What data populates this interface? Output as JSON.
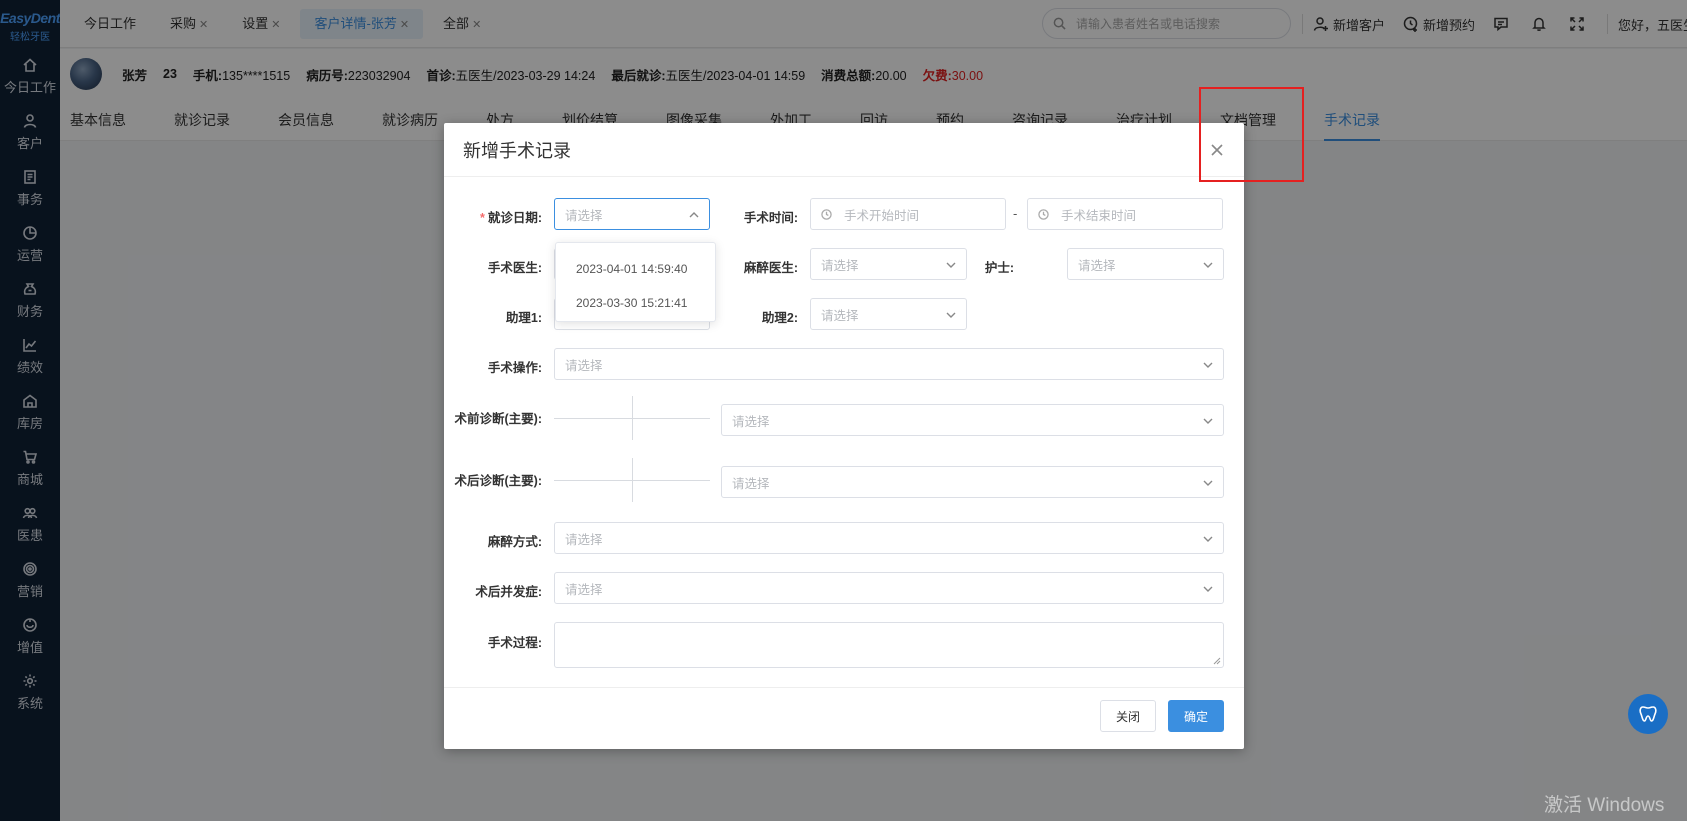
{
  "sidebar": {
    "logo": "EasyDent",
    "logo_sub": "轻松牙医",
    "items": [
      {
        "label": "今日工作",
        "icon": "home-icon"
      },
      {
        "label": "客户",
        "icon": "user-icon"
      },
      {
        "label": "事务",
        "icon": "document-icon"
      },
      {
        "label": "运营",
        "icon": "pie-chart-icon"
      },
      {
        "label": "财务",
        "icon": "money-bag-icon"
      },
      {
        "label": "绩效",
        "icon": "line-chart-icon"
      },
      {
        "label": "库房",
        "icon": "warehouse-icon"
      },
      {
        "label": "商城",
        "icon": "cart-icon"
      },
      {
        "label": "医患",
        "icon": "people-icon"
      },
      {
        "label": "营销",
        "icon": "target-icon"
      },
      {
        "label": "增值",
        "icon": "gift-icon"
      },
      {
        "label": "系统",
        "icon": "gear-icon"
      }
    ]
  },
  "topbar": {
    "tabs": [
      {
        "label": "今日工作",
        "closable": false
      },
      {
        "label": "采购",
        "closable": true
      },
      {
        "label": "设置",
        "closable": true
      },
      {
        "label": "客户详情-张芳",
        "closable": true,
        "active": true
      },
      {
        "label": "全部",
        "closable": true
      }
    ],
    "search_placeholder": "请输入患者姓名或电话搜索",
    "new_customer": "新增客户",
    "new_appointment": "新增预约",
    "greeting": "您好，五医生"
  },
  "patient": {
    "name": "张芳",
    "age": "23",
    "phone_label": "手机:",
    "phone": "135****1515",
    "record_label": "病历号:",
    "record": "223032904",
    "first_visit_label": "首诊:",
    "first_visit": "五医生/2023-03-29 14:24",
    "last_visit_label": "最后就诊:",
    "last_visit": "五医生/2023-04-01 14:59",
    "spend_label": "消费总额:",
    "spend": "20.00",
    "owe_label": "欠费:",
    "owe": "30.00"
  },
  "detail_tabs": [
    "基本信息",
    "就诊记录",
    "会员信息",
    "就诊病历",
    "处方",
    "划价结算",
    "图像采集",
    "外加工",
    "回访",
    "预约",
    "咨询记录",
    "治疗计划",
    "文档管理",
    "手术记录"
  ],
  "modal": {
    "title": "新增手术记录",
    "visit_date_label": "就诊日期:",
    "visit_date_placeholder": "请选择",
    "visit_date_options": [
      "2023-04-01 14:59:40",
      "2023-03-30 15:21:41"
    ],
    "surgery_time_label": "手术时间:",
    "start_placeholder": "手术开始时间",
    "end_placeholder": "手术结束时间",
    "range_sep": "-",
    "surgeon_label": "手术医生:",
    "anesthetist_label": "麻醉医生:",
    "anesthetist_placeholder": "请选择",
    "nurse_label": "护士:",
    "nurse_placeholder": "请选择",
    "assistant1_label": "助理1:",
    "assistant2_label": "助理2:",
    "assistant2_placeholder": "请选择",
    "operation_label": "手术操作:",
    "operation_placeholder": "请选择",
    "pre_diag_label": "术前诊断(主要):",
    "pre_diag_placeholder": "请选择",
    "post_diag_label": "术后诊断(主要):",
    "post_diag_placeholder": "请选择",
    "anesthesia_label": "麻醉方式:",
    "anesthesia_placeholder": "请选择",
    "complication_label": "术后并发症:",
    "complication_placeholder": "请选择",
    "process_label": "手术过程:",
    "close_button": "关闭",
    "confirm_button": "确定"
  },
  "watermark": "激活 Windows",
  "colors": {
    "accent": "#3b8fe0",
    "sidebar": "#0f2136",
    "highlight": "#e52020",
    "owe": "#e02020"
  }
}
